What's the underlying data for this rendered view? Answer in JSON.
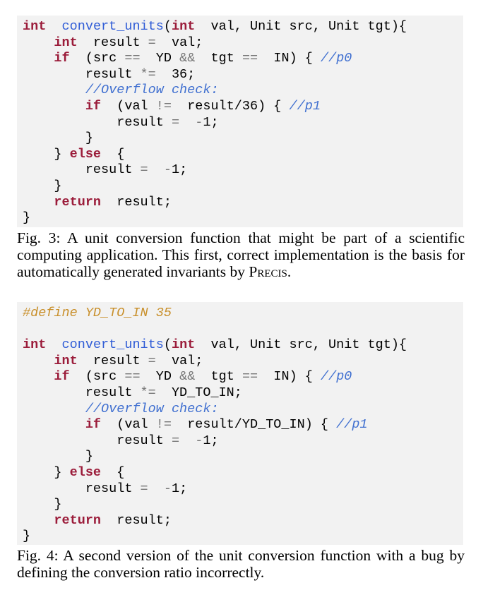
{
  "figure3": {
    "lines": [
      [
        {
          "t": "int",
          "c": "kw"
        },
        {
          "t": " "
        },
        {
          "t": "convert_units",
          "c": "fn"
        },
        {
          "t": "("
        },
        {
          "t": "int",
          "c": "kw"
        },
        {
          "t": " val, Unit src, Unit tgt){"
        }
      ],
      [
        {
          "t": "  "
        },
        {
          "t": "int",
          "c": "kw"
        },
        {
          "t": " result "
        },
        {
          "t": "=",
          "c": "op"
        },
        {
          "t": " val;"
        }
      ],
      [
        {
          "t": "  "
        },
        {
          "t": "if",
          "c": "kw"
        },
        {
          "t": " (src "
        },
        {
          "t": "==",
          "c": "op"
        },
        {
          "t": " YD "
        },
        {
          "t": "&&",
          "c": "op"
        },
        {
          "t": " tgt "
        },
        {
          "t": "==",
          "c": "op"
        },
        {
          "t": " IN) { "
        },
        {
          "t": "//p0",
          "c": "cm"
        }
      ],
      [
        {
          "t": "    result "
        },
        {
          "t": "*=",
          "c": "op"
        },
        {
          "t": " 36;"
        }
      ],
      [
        {
          "t": "    "
        },
        {
          "t": "//Overflow check:",
          "c": "cm"
        }
      ],
      [
        {
          "t": "    "
        },
        {
          "t": "if",
          "c": "kw"
        },
        {
          "t": " (val "
        },
        {
          "t": "!=",
          "c": "op"
        },
        {
          "t": " result/36) { "
        },
        {
          "t": "//p1",
          "c": "cm"
        }
      ],
      [
        {
          "t": "      result "
        },
        {
          "t": "=",
          "c": "op"
        },
        {
          "t": " "
        },
        {
          "t": "-",
          "c": "op"
        },
        {
          "t": "1;"
        }
      ],
      [
        {
          "t": "    }"
        }
      ],
      [
        {
          "t": "  } "
        },
        {
          "t": "else",
          "c": "kw"
        },
        {
          "t": " {"
        }
      ],
      [
        {
          "t": "    result "
        },
        {
          "t": "=",
          "c": "op"
        },
        {
          "t": " "
        },
        {
          "t": "-",
          "c": "op"
        },
        {
          "t": "1;"
        }
      ],
      [
        {
          "t": "  }"
        }
      ],
      [
        {
          "t": "  "
        },
        {
          "t": "return",
          "c": "kw"
        },
        {
          "t": " result;"
        }
      ],
      [
        {
          "t": "}"
        }
      ]
    ],
    "caption_prefix": "Fig. 3: A unit conversion function that might be part of a scientific computing application. This first, correct implementation is the basis for automatically generated invariants by ",
    "caption_tool": "Precis",
    "caption_suffix": "."
  },
  "figure4": {
    "lines": [
      [
        {
          "t": "#define YD_TO_IN 35",
          "c": "pp"
        }
      ],
      [
        {
          "t": ""
        }
      ],
      [
        {
          "t": "int",
          "c": "kw"
        },
        {
          "t": " "
        },
        {
          "t": "convert_units",
          "c": "fn"
        },
        {
          "t": "("
        },
        {
          "t": "int",
          "c": "kw"
        },
        {
          "t": " val, Unit src, Unit tgt){"
        }
      ],
      [
        {
          "t": "  "
        },
        {
          "t": "int",
          "c": "kw"
        },
        {
          "t": " result "
        },
        {
          "t": "=",
          "c": "op"
        },
        {
          "t": " val;"
        }
      ],
      [
        {
          "t": "  "
        },
        {
          "t": "if",
          "c": "kw"
        },
        {
          "t": " (src "
        },
        {
          "t": "==",
          "c": "op"
        },
        {
          "t": " YD "
        },
        {
          "t": "&&",
          "c": "op"
        },
        {
          "t": " tgt "
        },
        {
          "t": "==",
          "c": "op"
        },
        {
          "t": " IN) { "
        },
        {
          "t": "//p0",
          "c": "cm"
        }
      ],
      [
        {
          "t": "    result "
        },
        {
          "t": "*=",
          "c": "op"
        },
        {
          "t": " YD_TO_IN;"
        }
      ],
      [
        {
          "t": "    "
        },
        {
          "t": "//Overflow check:",
          "c": "cm"
        }
      ],
      [
        {
          "t": "    "
        },
        {
          "t": "if",
          "c": "kw"
        },
        {
          "t": " (val "
        },
        {
          "t": "!=",
          "c": "op"
        },
        {
          "t": " result/YD_TO_IN) { "
        },
        {
          "t": "//p1",
          "c": "cm"
        }
      ],
      [
        {
          "t": "      result "
        },
        {
          "t": "=",
          "c": "op"
        },
        {
          "t": " "
        },
        {
          "t": "-",
          "c": "op"
        },
        {
          "t": "1;"
        }
      ],
      [
        {
          "t": "    }"
        }
      ],
      [
        {
          "t": "  } "
        },
        {
          "t": "else",
          "c": "kw"
        },
        {
          "t": " {"
        }
      ],
      [
        {
          "t": "    result "
        },
        {
          "t": "=",
          "c": "op"
        },
        {
          "t": " "
        },
        {
          "t": "-",
          "c": "op"
        },
        {
          "t": "1;"
        }
      ],
      [
        {
          "t": "  }"
        }
      ],
      [
        {
          "t": "  "
        },
        {
          "t": "return",
          "c": "kw"
        },
        {
          "t": " result;"
        }
      ],
      [
        {
          "t": "}"
        }
      ]
    ],
    "caption": "Fig. 4: A second version of the unit conversion function with a bug by defining the conversion ratio incorrectly."
  },
  "colors": {
    "code_background": "#f2f2f2",
    "keyword": "#9b1c3a",
    "function_name": "#2e5bd6",
    "comment": "#3f6fd0",
    "preprocessor": "#c9902c",
    "operator": "#777777"
  }
}
